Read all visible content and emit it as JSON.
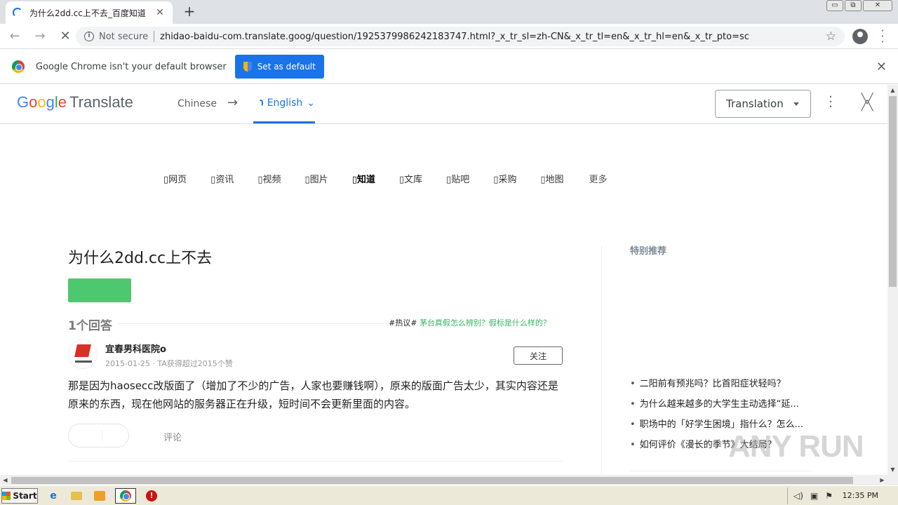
{
  "browser": {
    "tab_title": "为什么2dd.cc上不去_百度知道",
    "new_tab": "+",
    "tab_close": "✕",
    "window_controls": [
      "▭",
      "⧉",
      "✕"
    ],
    "not_secure": "Not secure",
    "url": "zhidao-baidu-com.translate.goog/question/1925379986242183747.html?_x_tr_sl=zh-CN&_x_tr_tl=en&_x_tr_hl=en&_x_tr_pto=sc"
  },
  "infobar": {
    "message": "Google Chrome isn't your default browser",
    "button": "Set as default",
    "close": "✕"
  },
  "translate_bar": {
    "logo_letters": [
      "G",
      "o",
      "o",
      "g",
      "l",
      "e"
    ],
    "logo_suffix": "Translate",
    "source_lang": "Chinese",
    "arrow": "→",
    "target_lang": "English",
    "mode": "Translation"
  },
  "baidu": {
    "nav": [
      "网页",
      "资讯",
      "视频",
      "图片",
      "知道",
      "文库",
      "贴吧",
      "采购",
      "地图"
    ],
    "nav_active": "知道",
    "nav_more": "更多",
    "question_title": "为什么2dd.cc上不去",
    "answers_count": "1个回答",
    "hot_tag": "#热议#",
    "hot_link": "茅台真假怎么辨别？假标是什么样的？",
    "author": "宜春男科医院o",
    "author_meta": "2015-01-25 · TA获得超过2015个赞",
    "follow": "关注",
    "answer_text": "那是因为haosecc改版面了（增加了不少的广告，人家也要赚钱啊），原来的版面广告太少，其实内容还是原来的东西，现在他网站的服务器正在升级，短时间不会更新里面的内容。",
    "comment": "评论",
    "sidebar_title": "特别推荐",
    "recommendations": [
      "二阳前有预兆吗？比首阳症状轻吗？",
      "为什么越来越多的大学生主动选择“延...",
      "职场中的「好学生困境」指什么？怎么...",
      "如何评价《漫长的季节》大结局？"
    ]
  },
  "watermark": "ANY RUN",
  "taskbar": {
    "start": "Start",
    "clock": "12:35 PM"
  },
  "colors": {
    "chrome_blue": "#1a73e8",
    "baidu_green": "#4ec86e",
    "hot_green": "#38b464"
  }
}
